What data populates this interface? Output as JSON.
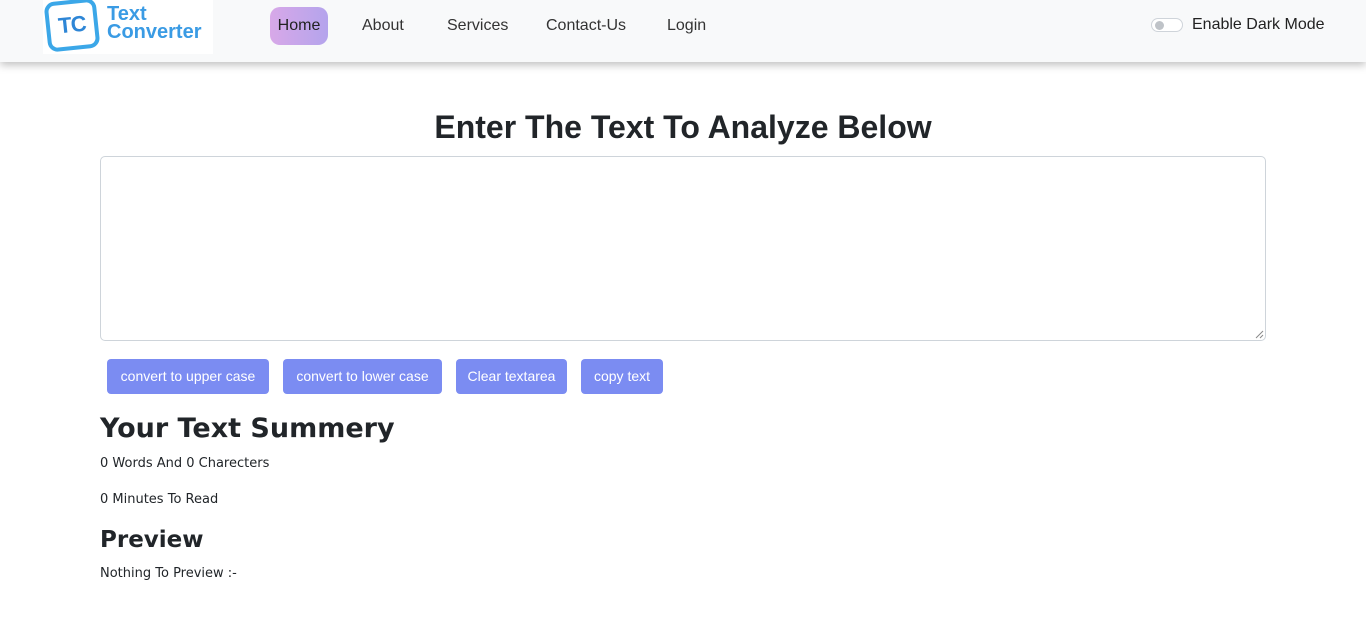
{
  "logo": {
    "badge": "TC",
    "line1": "Text",
    "line2": "Converter"
  },
  "nav": {
    "items": [
      {
        "label": "Home",
        "active": true
      },
      {
        "label": "About"
      },
      {
        "label": "Services"
      },
      {
        "label": "Contact-Us"
      },
      {
        "label": "Login"
      }
    ]
  },
  "dark_mode": {
    "label": "Enable Dark Mode",
    "enabled": false
  },
  "main": {
    "heading": "Enter The Text To Analyze Below",
    "textarea_value": "",
    "buttons": [
      {
        "label": "convert to upper case"
      },
      {
        "label": "convert to lower case"
      },
      {
        "label": "Clear textarea"
      },
      {
        "label": "copy text"
      }
    ]
  },
  "summary": {
    "title": "Your Text Summery",
    "counts": "0 Words And 0 Charecters",
    "read_time": "0 Minutes To Read"
  },
  "preview": {
    "title": "Preview",
    "text": "Nothing To Preview :-"
  },
  "colors": {
    "button": "#7b8cf2",
    "active_nav": "#c8a6ea",
    "logo_blue": "#3a9be4"
  }
}
